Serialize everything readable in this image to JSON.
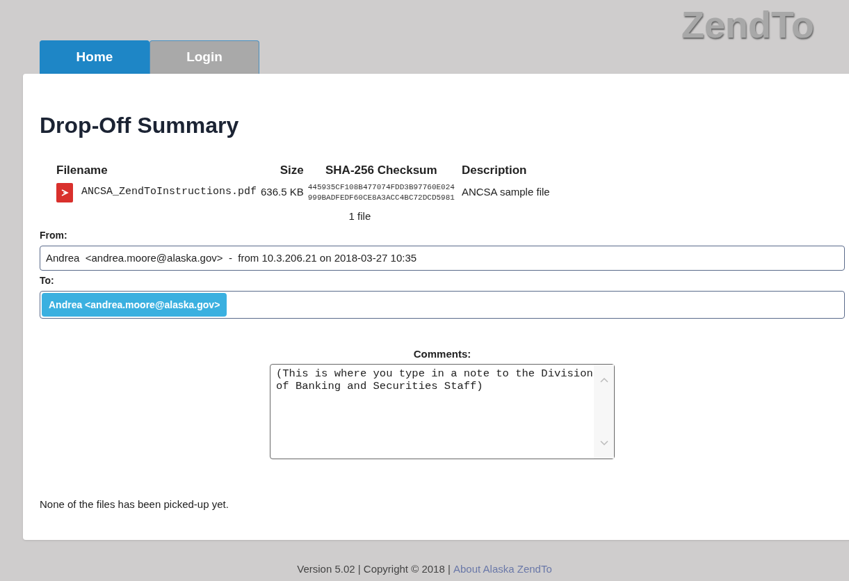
{
  "logo": "ZendTo",
  "tabs": [
    {
      "label": "Home",
      "selected": true
    },
    {
      "label": "Login",
      "selected": false
    }
  ],
  "heading": "Drop-Off Summary",
  "files": {
    "columns": [
      "Filename",
      "Size",
      "SHA-256 Checksum",
      "Description"
    ],
    "rows": [
      {
        "kind": "pdf",
        "filename": "ANCSA_ZendToInstructions.pdf",
        "size": "636.5 KB",
        "checksum": [
          "445935CF108B477074FDD3B97760E024",
          "999BADFEDF60CE8A3ACC4BC72DCD5981"
        ],
        "description": "ANCSA sample file"
      }
    ],
    "count": "1 file"
  },
  "from": {
    "label": "From:",
    "value": "Andrea  <andrea.moore@alaska.gov>  -  from 10.3.206.21 on 2018-03-27 10:35"
  },
  "to": {
    "label": "To:",
    "recipients": [
      "Andrea <andrea.moore@alaska.gov>"
    ]
  },
  "comments": {
    "label": "Comments:",
    "value": "(This is where you type in a note to the Division of Banking and Securities Staff)"
  },
  "status": "None of the files has been picked-up yet.",
  "footer": {
    "text": "Version 5.02 | Copyright © 2018 | ",
    "link": "About Alaska ZendTo"
  }
}
